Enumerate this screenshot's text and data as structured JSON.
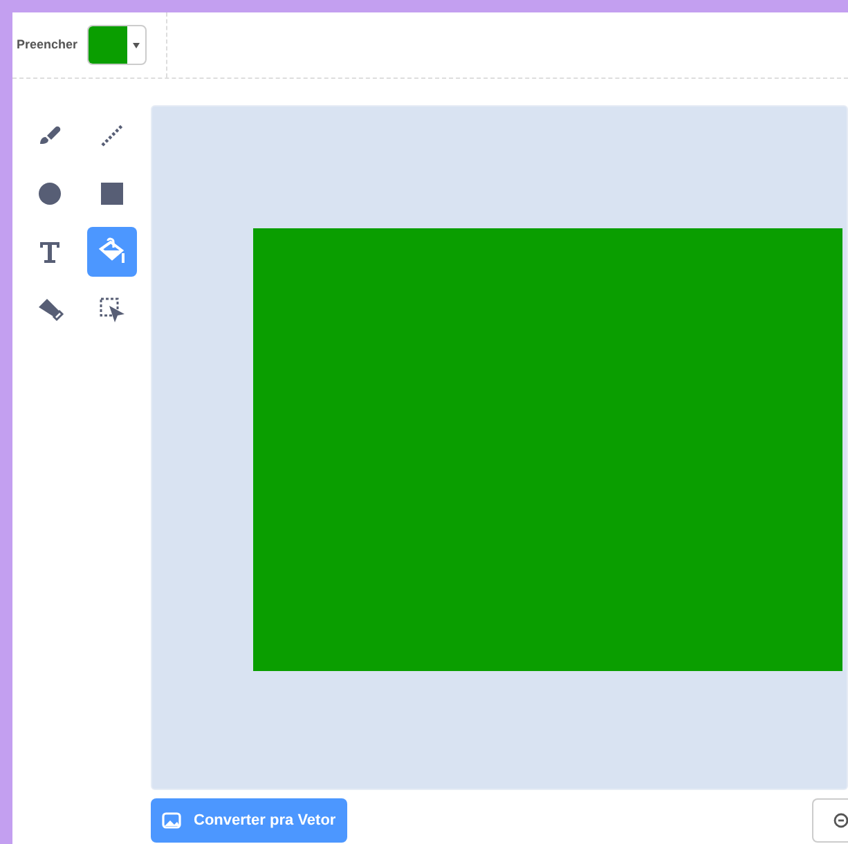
{
  "fill": {
    "label": "Preencher",
    "color": "#0a9e00"
  },
  "tools": [
    {
      "kind": "brush",
      "selected": false
    },
    {
      "kind": "line",
      "selected": false
    },
    {
      "kind": "circle",
      "selected": false
    },
    {
      "kind": "rect",
      "selected": false
    },
    {
      "kind": "text",
      "selected": false
    },
    {
      "kind": "fill",
      "selected": true
    },
    {
      "kind": "eraser",
      "selected": false
    },
    {
      "kind": "select",
      "selected": false
    }
  ],
  "convert_button": {
    "label": "Converter pra Vetor"
  }
}
